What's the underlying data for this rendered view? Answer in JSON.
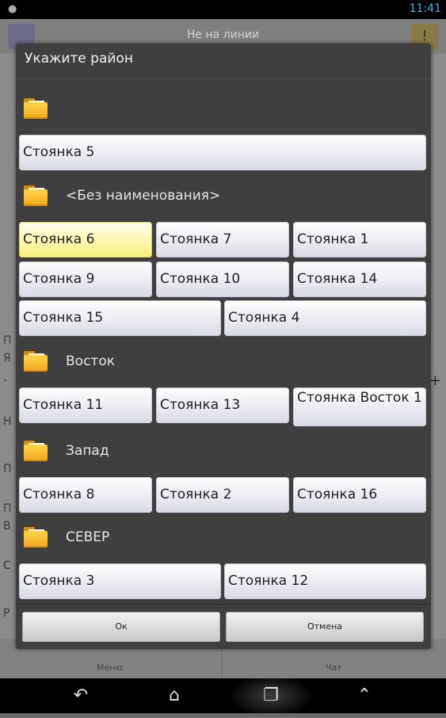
{
  "status_bar": {
    "time": "11:41"
  },
  "app": {
    "title": "Не на линии",
    "bottom": {
      "menu": "Меню",
      "chat": "Чат"
    },
    "side_letters": [
      "П",
      "Я",
      "-",
      "Н",
      "П",
      "П",
      "В",
      "С",
      "Р"
    ],
    "plus": "+"
  },
  "dialog": {
    "title": "Укажите район",
    "groups": [
      {
        "name": "",
        "items": [
          "Стоянка 5"
        ]
      },
      {
        "name": "<Без наименования>",
        "items": [
          "Стоянка 6",
          "Стоянка 7",
          "Стоянка 1",
          "Стоянка 9",
          "Стоянка 10",
          "Стоянка 14",
          "Стоянка 15",
          "Стоянка 4"
        ],
        "selected": "Стоянка 6"
      },
      {
        "name": "Восток",
        "items": [
          "Стоянка 11",
          "Стоянка 13",
          "Стоянка Восток 1"
        ]
      },
      {
        "name": "Запад",
        "items": [
          "Стоянка 8",
          "Стоянка 2",
          "Стоянка 16"
        ]
      },
      {
        "name": "СЕВЕР",
        "items": [
          "Стоянка 3",
          "Стоянка 12"
        ]
      }
    ],
    "ok_label": "Ок",
    "cancel_label": "Отмена"
  },
  "icons": {
    "folder": "folder-icon",
    "back": "back-icon",
    "home": "home-icon",
    "recents": "recent-apps-icon",
    "up": "up-chevron-icon",
    "warning": "warning-icon",
    "phone": "phone-icon"
  }
}
